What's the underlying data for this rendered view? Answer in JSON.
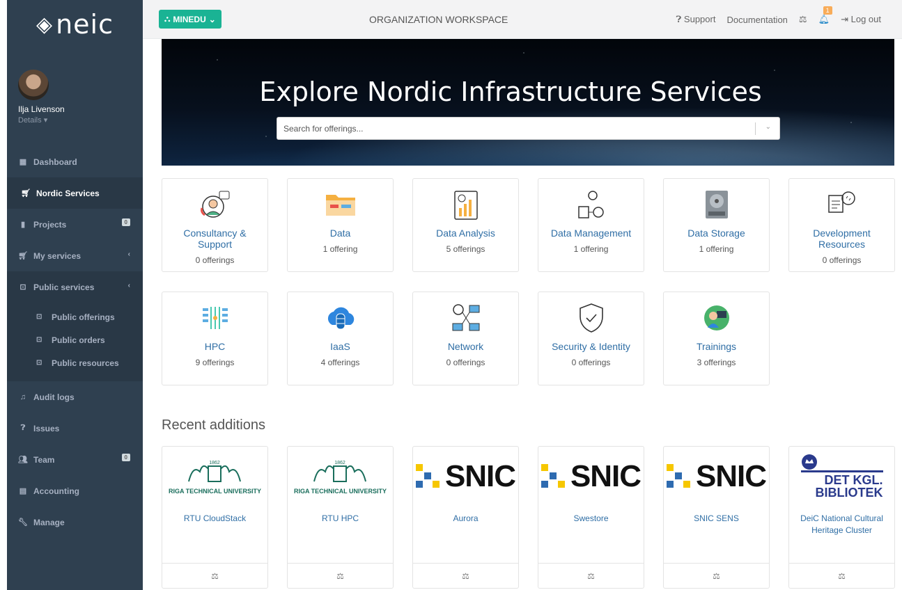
{
  "brand": {
    "logo_text": "neic"
  },
  "user": {
    "name": "Ilja Livenson",
    "details_label": "Details"
  },
  "sidebar": {
    "items": [
      {
        "label": "Dashboard",
        "icon": "dashboard-icon"
      },
      {
        "label": "Nordic Services",
        "icon": "cart-icon"
      },
      {
        "label": "Projects",
        "icon": "bookmark-icon",
        "badge": "0"
      },
      {
        "label": "My services",
        "icon": "cart-icon"
      },
      {
        "label": "Public services",
        "icon": "storefront-icon"
      },
      {
        "label": "Audit logs",
        "icon": "bell-icon"
      },
      {
        "label": "Issues",
        "icon": "question-icon"
      },
      {
        "label": "Team",
        "icon": "users-icon",
        "badge": "0"
      },
      {
        "label": "Accounting",
        "icon": "file-icon"
      },
      {
        "label": "Manage",
        "icon": "wrench-icon"
      }
    ],
    "public_sub": [
      {
        "label": "Public offerings"
      },
      {
        "label": "Public orders"
      },
      {
        "label": "Public resources"
      }
    ]
  },
  "topbar": {
    "org_button": "MINEDU",
    "workspace": "ORGANIZATION WORKSPACE",
    "support": "Support",
    "documentation": "Documentation",
    "notifications_count": "1",
    "logout": "Log out"
  },
  "hero": {
    "title": "Explore Nordic Infrastructure Services",
    "search_placeholder": "Search for offerings..."
  },
  "categories": [
    {
      "title": "Consultancy & Support",
      "count": "0 offerings"
    },
    {
      "title": "Data",
      "count": "1 offering"
    },
    {
      "title": "Data Analysis",
      "count": "5 offerings"
    },
    {
      "title": "Data Management",
      "count": "1 offering"
    },
    {
      "title": "Data Storage",
      "count": "1 offering"
    },
    {
      "title": "Development Resources",
      "count": "0 offerings"
    },
    {
      "title": "HPC",
      "count": "9 offerings"
    },
    {
      "title": "IaaS",
      "count": "4 offerings"
    },
    {
      "title": "Network",
      "count": "0 offerings"
    },
    {
      "title": "Security & Identity",
      "count": "0 offerings"
    },
    {
      "title": "Trainings",
      "count": "3 offerings"
    }
  ],
  "recent": {
    "title": "Recent additions",
    "items": [
      {
        "title": "RTU CloudStack",
        "logo": "RIGA TECHNICAL UNIVERSITY",
        "year": "1862"
      },
      {
        "title": "RTU HPC",
        "logo": "RIGA TECHNICAL UNIVERSITY",
        "year": "1862"
      },
      {
        "title": "Aurora",
        "logo": "SNIC"
      },
      {
        "title": "Swestore",
        "logo": "SNIC"
      },
      {
        "title": "SNIC SENS",
        "logo": "SNIC"
      },
      {
        "title": "DeiC National Cultural Heritage Cluster",
        "logo": "DET KGL. BIBLIOTEK"
      }
    ]
  },
  "colors": {
    "sidebar": "#2f4050",
    "accent": "#1ab394",
    "link": "#2f6ea5"
  }
}
